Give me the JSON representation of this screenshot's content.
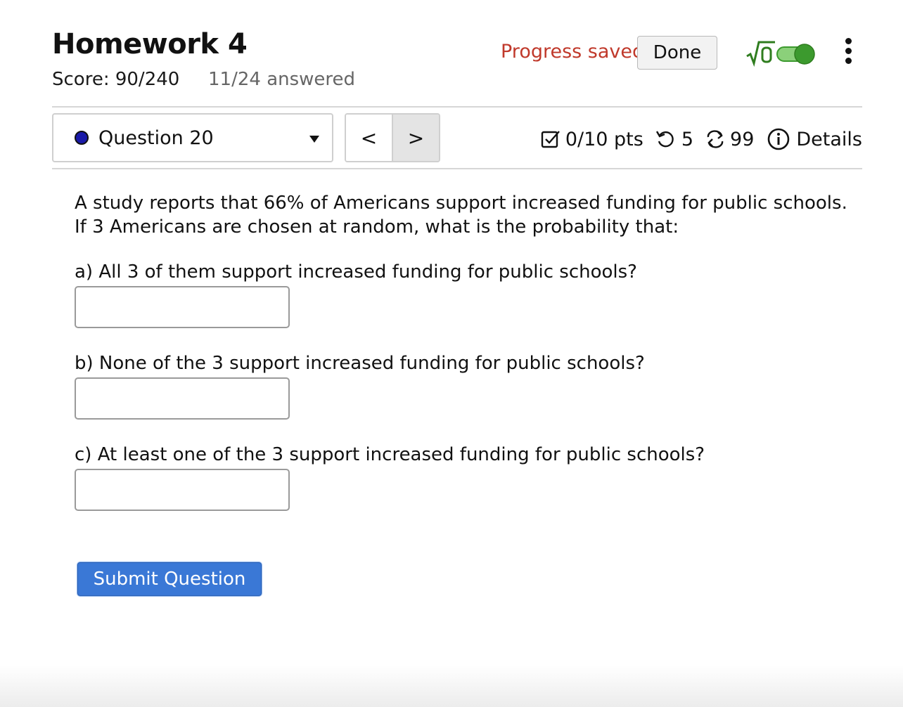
{
  "header": {
    "title": "Homework 4",
    "score": "Score: 90/240",
    "answered": "11/24 answered",
    "progress_status": "Progress saved",
    "done_label": "Done",
    "math_toggle_on": true
  },
  "question_nav": {
    "selected_question": "Question 20",
    "prev_label": "<",
    "next_label": ">"
  },
  "meta": {
    "points": "0/10 pts",
    "retries": "5",
    "attempts": "99",
    "details_label": "Details"
  },
  "question": {
    "stem_line1": "A study reports that 66% of Americans support increased funding for public schools.",
    "stem_line2": "If 3 Americans are chosen at random, what is the probability that:",
    "parts": [
      {
        "label": "a) All 3 of them support increased funding for public schools?",
        "value": ""
      },
      {
        "label": "b) None of the 3 support increased funding for public schools?",
        "value": ""
      },
      {
        "label": "c) At least one of the 3 support increased funding for public schools?",
        "value": ""
      }
    ]
  },
  "submit_label": "Submit Question",
  "colors": {
    "progress_saved": "#c0392b",
    "toggle_green": "#3c9a2e",
    "sqrt_green": "#2f7d1f",
    "submit_blue": "#3a78d6",
    "question_dot": "#1a1aa8"
  }
}
